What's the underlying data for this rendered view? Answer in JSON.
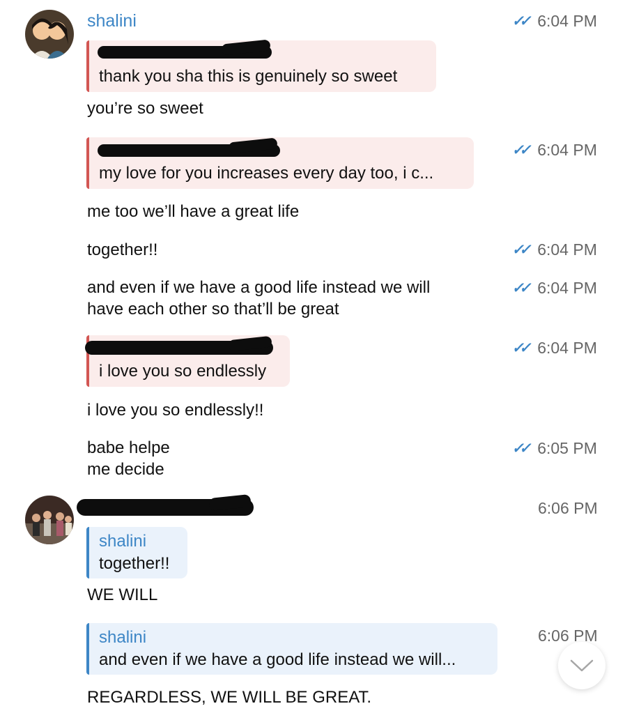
{
  "messages_a": {
    "sender": "shalini",
    "t1": "6:04 PM",
    "q1_text": "thank you sha this is genuinely so sweet",
    "m1": "you’re so sweet",
    "t2": "6:04 PM",
    "q2_text": "my love for you increases every day too, i c...",
    "m2": "me too we’ll have a great life",
    "m3": "together!!",
    "t3": "6:04 PM",
    "m4_l1": "and even if we have a good life instead we will",
    "m4_l2": "have each other so that’ll be great",
    "t4": "6:04 PM",
    "t5": "6:04 PM",
    "q3_text": "i love you so endlessly",
    "m5": "i love you so endlessly!!",
    "m6_l1": "babe helpe",
    "m6_l2": "me decide",
    "t6": "6:05 PM"
  },
  "messages_b": {
    "t1": "6:06 PM",
    "q1_name": "shalini",
    "q1_text": "together!!",
    "m1": "WE WILL",
    "t2": "6:06 PM",
    "q2_name": "shalini",
    "q2_text": "and even if we have a good life instead we will...",
    "m2": "REGARDLESS, WE WILL BE GREAT."
  },
  "colors": {
    "accent": "#3d86c6",
    "reply_red": "#d25653",
    "reply_red_bg": "#fbeceb",
    "reply_blue_bg": "#eaf2fb"
  },
  "icons": {
    "read_receipt": "double-check-icon",
    "scroll_down": "chevron-down-icon"
  }
}
